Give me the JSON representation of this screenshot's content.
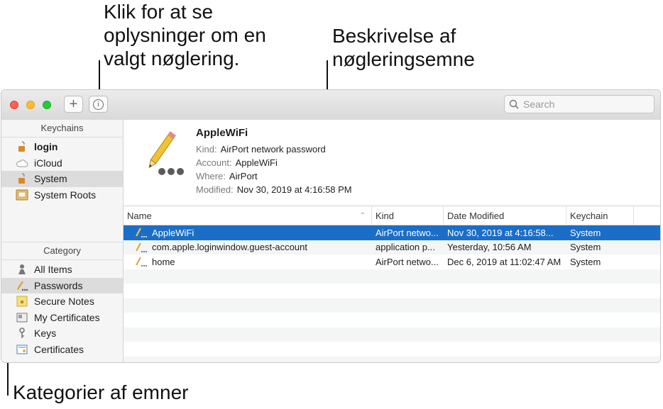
{
  "callouts": {
    "info_callout": "Klik for at se\noplysninger om en\nvalgt nøglering.",
    "description_callout": "Beskrivelse af\nnøgleringsemne",
    "category_callout": "Kategorier af emner"
  },
  "toolbar": {
    "add_label": "+",
    "info_label": "i",
    "search_placeholder": "Search"
  },
  "sidebar": {
    "keychains_header": "Keychains",
    "keychains": [
      {
        "label": "login"
      },
      {
        "label": "iCloud"
      },
      {
        "label": "System"
      },
      {
        "label": "System Roots"
      }
    ],
    "category_header": "Category",
    "categories": [
      {
        "label": "All Items"
      },
      {
        "label": "Passwords"
      },
      {
        "label": "Secure Notes"
      },
      {
        "label": "My Certificates"
      },
      {
        "label": "Keys"
      },
      {
        "label": "Certificates"
      }
    ]
  },
  "detail": {
    "title": "AppleWiFi",
    "kind_label": "Kind:",
    "kind_value": "AirPort network password",
    "account_label": "Account:",
    "account_value": "AppleWiFi",
    "where_label": "Where:",
    "where_value": "AirPort",
    "modified_label": "Modified:",
    "modified_value": "Nov 30, 2019 at 4:16:58 PM"
  },
  "table": {
    "columns": [
      "Name",
      "Kind",
      "Date Modified",
      "Keychain"
    ],
    "rows": [
      {
        "name": "AppleWiFi",
        "kind": "AirPort netwo...",
        "date": "Nov 30, 2019 at 4:16:58...",
        "keychain": "System"
      },
      {
        "name": "com.apple.loginwindow.guest-account",
        "kind": "application p...",
        "date": "Yesterday, 10:56 AM",
        "keychain": "System"
      },
      {
        "name": "home",
        "kind": "AirPort netwo...",
        "date": "Dec 6, 2019 at 11:02:47 AM",
        "keychain": "System"
      }
    ]
  },
  "colors": {
    "selection": "#1b6ec7",
    "close": "#fe5f57",
    "minimize": "#febc2e",
    "zoom": "#28c840"
  }
}
